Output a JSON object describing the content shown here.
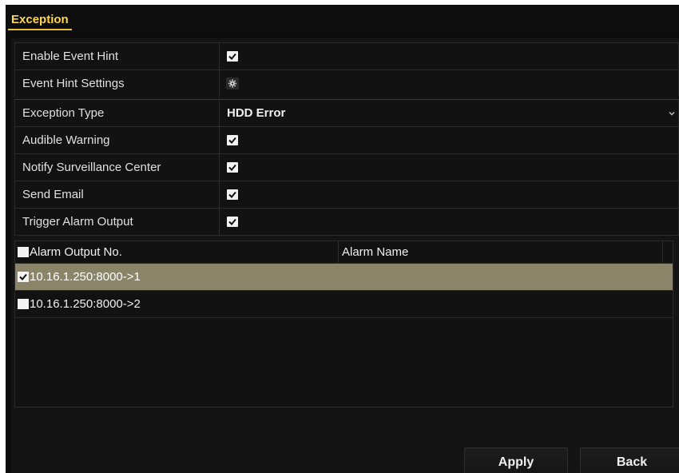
{
  "tab": {
    "label": "Exception"
  },
  "settings": {
    "enable_event_hint": {
      "label": "Enable Event Hint",
      "checked": true
    },
    "event_hint_settings": {
      "label": "Event Hint Settings",
      "icon": "gear-icon"
    },
    "exception_type": {
      "label": "Exception Type",
      "value": "HDD Error"
    },
    "audible_warning": {
      "label": "Audible Warning",
      "checked": true
    },
    "notify_center": {
      "label": "Notify Surveillance Center",
      "checked": true
    },
    "send_email": {
      "label": "Send Email",
      "checked": true
    },
    "trigger_alarm": {
      "label": "Trigger Alarm Output",
      "checked": true
    }
  },
  "alarm_table": {
    "columns": [
      "Alarm Output No.",
      "Alarm Name"
    ],
    "rows": [
      {
        "output": "10.16.1.250:8000->1",
        "name": "",
        "checked": true,
        "selected": true
      },
      {
        "output": "10.16.1.250:8000->2",
        "name": "",
        "checked": false,
        "selected": false
      }
    ]
  },
  "buttons": {
    "apply": "Apply",
    "back": "Back"
  },
  "colors": {
    "accent": "#ffd64a",
    "selected_row": "#8a8468",
    "background": "#0c0c0c"
  }
}
